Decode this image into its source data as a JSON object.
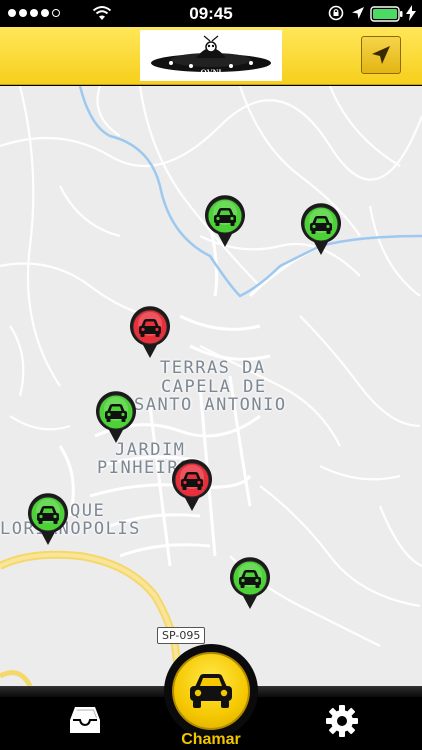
{
  "status_bar": {
    "time": "09:45",
    "signal_icon": "signal-dots-icon",
    "wifi_icon": "wifi-icon",
    "lock_icon": "rotation-lock-icon",
    "location_icon": "location-arrow-icon",
    "battery_icon": "battery-charging-icon",
    "battery_color": "#4cd964"
  },
  "header": {
    "logo_text": "OVNI",
    "background": "#f7d42a",
    "locate_icon": "navigation-arrow-icon"
  },
  "map": {
    "labels": [
      "TERRAS DA",
      "CAPELA DE",
      "SANTO ANTONIO",
      "JARDIM",
      "PINHEIRO",
      "QUE",
      "LORIANOPOLIS"
    ],
    "road_shield": "SP-095",
    "markers": [
      {
        "status": "available",
        "color": "#4cd137"
      },
      {
        "status": "available",
        "color": "#4cd137"
      },
      {
        "status": "busy",
        "color": "#e8303b"
      },
      {
        "status": "available",
        "color": "#4cd137"
      },
      {
        "status": "busy",
        "color": "#e8303b"
      },
      {
        "status": "available",
        "color": "#4cd137"
      },
      {
        "status": "available",
        "color": "#4cd137"
      }
    ]
  },
  "tab_bar": {
    "inbox_icon": "inbox-tray-icon",
    "call_icon": "car-icon",
    "call_label": "Chamar",
    "settings_icon": "gear-icon",
    "accent": "#f2c500"
  }
}
